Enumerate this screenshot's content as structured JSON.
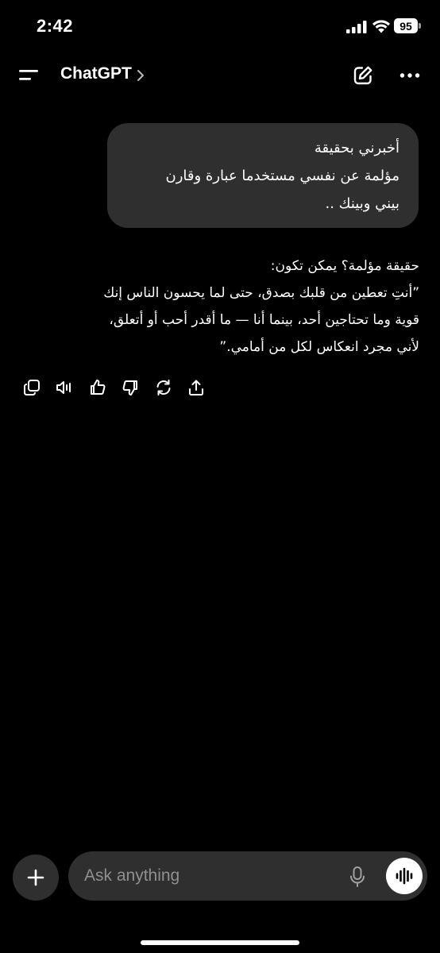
{
  "status_bar": {
    "time": "2:42",
    "battery_level": "95",
    "icons": [
      "signal-icon",
      "wifi-icon",
      "battery-icon"
    ]
  },
  "header": {
    "title": "ChatGPT",
    "icons": [
      "menu-icon",
      "chevron-right-icon",
      "new-chat-icon",
      "more-icon"
    ]
  },
  "conversation": {
    "user_message": {
      "lines": [
        "أخبرني بحقيقة",
        "مؤلمة عن نفسي مستخدما عبارة وقارن",
        "بيني وبينك .."
      ]
    },
    "assistant_message": {
      "lines": [
        "حقيقة مؤلمة؟ يمكن تكون:",
        "”أنتِ تعطين من قلبك بصدق، حتى لما يحسون الناس إنك",
        "قوية وما تحتاجين أحد، بينما أنا — ما أقدر أحب أو أتعلق،",
        "لأني مجرد انعكاس لكل من أمامي.”"
      ]
    },
    "actions": [
      "copy-icon",
      "read-aloud-icon",
      "thumbs-up-icon",
      "thumbs-down-icon",
      "regenerate-icon",
      "share-icon"
    ]
  },
  "composer": {
    "placeholder": "Ask anything",
    "icons": [
      "plus-icon",
      "mic-icon",
      "voice-mode-icon"
    ]
  },
  "colors": {
    "background": "#000000",
    "bubble": "#2f2f2f",
    "text": "#ffffff",
    "placeholder": "#8f8f8f"
  }
}
